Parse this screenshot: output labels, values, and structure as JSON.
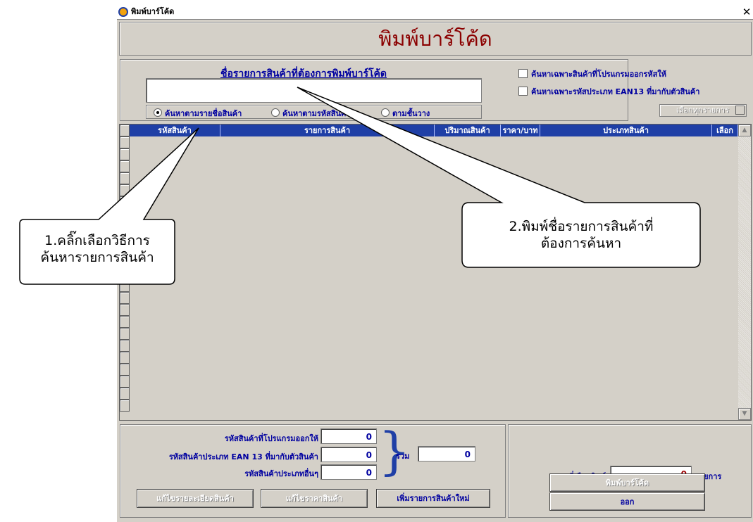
{
  "window": {
    "title": "พิมพ์บาร์โค้ด",
    "close_glyph": "✕"
  },
  "header": {
    "title": "พิมพ์บาร์โค้ด"
  },
  "search": {
    "label": "ชื่อรายการสินค้าที่ต้องการพิมพ์บาร์โค้ด",
    "value": "",
    "radios": [
      {
        "label": "ค้นหาตามรายชื่อสินค้า",
        "selected": true
      },
      {
        "label": "ค้นหาตามรหัสสินค้า",
        "selected": false
      },
      {
        "label": "ตามชั้นวาง",
        "selected": false
      }
    ]
  },
  "filters": {
    "only_program_codes": "ค้นหาเฉพาะสินค้าที่โปรแกรมออกรหัสให้",
    "only_ean13": "ค้นหาเฉพาะรหัสประเภท EAN13 ที่มากับตัวสินค้า",
    "select_all": "เลือกทุกรายการ"
  },
  "grid": {
    "columns": [
      "รหัสสินค้า",
      "รายการสินค้า",
      "ปริมาณสินค้า",
      "ราคา/บาท",
      "ประเภทสินค้า",
      "เลือก"
    ],
    "rows": []
  },
  "totals": {
    "program_generated_label": "รหัสสินค้าที่โปรแกรมออกให้",
    "program_generated_value": "0",
    "ean13_label": "รหัสสินค้าประเภท EAN 13 ที่มากับตัวสินค้า",
    "ean13_value": "0",
    "other_label": "รหัสสินค้าประเภทอื่นๆ",
    "other_value": "0",
    "sum_label": "รวม",
    "sum_value": "0"
  },
  "actions": {
    "edit_details": "แก้ไขรายละเอียดสินค้า",
    "edit_price": "แก้ไขราคาสินค้า",
    "add_product": "เพิ่มรายการสินค้าใหม่"
  },
  "print": {
    "selected_label": "รวมที่เลือกพิมพ์",
    "selected_value": "0",
    "unit": "รายการ",
    "print_button": "พิมพ์บาร์โค้ด",
    "exit_button": "ออก"
  },
  "callouts": {
    "first_line1": "1.คลิ๊กเลือกวิธีการ",
    "first_line2": "ค้นหารายการสินค้า",
    "second_line1": "2.พิมพ์ชื่อรายการสินค้าที่",
    "second_line2": "ต้องการค้นหา"
  }
}
